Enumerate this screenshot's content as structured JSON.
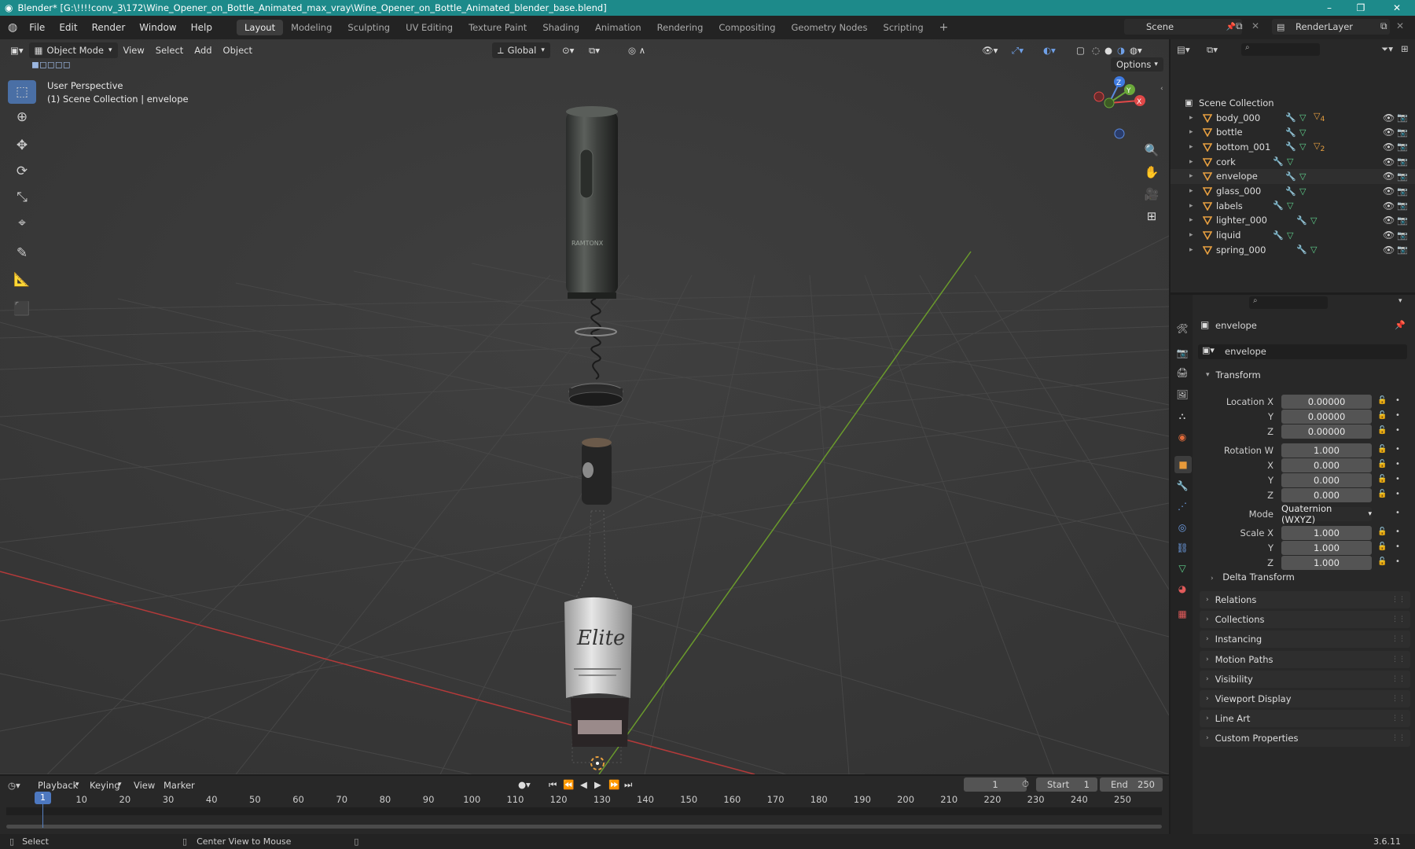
{
  "titlebar": {
    "title": "Blender* [G:\\!!!!conv_3\\172\\Wine_Opener_on_Bottle_Animated_max_vray\\Wine_Opener_on_Bottle_Animated_blender_base.blend]",
    "minimize": "–",
    "maximize": "❐",
    "close": "✕"
  },
  "menu": {
    "items": [
      "File",
      "Edit",
      "Render",
      "Window",
      "Help"
    ],
    "workspaces": [
      "Layout",
      "Modeling",
      "Sculpting",
      "UV Editing",
      "Texture Paint",
      "Shading",
      "Animation",
      "Rendering",
      "Compositing",
      "Geometry Nodes",
      "Scripting"
    ],
    "active_workspace": "Layout",
    "add_tab": "+",
    "scene": "Scene",
    "render_layer": "RenderLayer"
  },
  "viewport": {
    "mode": "Object Mode",
    "menus": [
      "View",
      "Select",
      "Add",
      "Object"
    ],
    "orientation": "Global",
    "options": "Options",
    "perspective_label": "User Perspective",
    "collection_label": "(1) Scene Collection | envelope",
    "bottle_label_text": "Elite",
    "brand_text": "RAMTONX",
    "gizmo_axes": {
      "x": "X",
      "y": "Y",
      "z": "Z"
    }
  },
  "outliner": {
    "root": "Scene Collection",
    "items": [
      {
        "name": "body_000",
        "extra_count": "4"
      },
      {
        "name": "bottle",
        "extra_count": ""
      },
      {
        "name": "bottom_001",
        "extra_count": "2"
      },
      {
        "name": "cork",
        "extra_count": ""
      },
      {
        "name": "envelope",
        "extra_count": ""
      },
      {
        "name": "glass_000",
        "extra_count": ""
      },
      {
        "name": "labels",
        "extra_count": ""
      },
      {
        "name": "lighter_000",
        "extra_count": ""
      },
      {
        "name": "liquid",
        "extra_count": ""
      },
      {
        "name": "spring_000",
        "extra_count": ""
      }
    ]
  },
  "properties": {
    "object_name": "envelope",
    "object_field": "envelope",
    "transform_header": "Transform",
    "location_label": "Location X",
    "location": [
      "0.00000",
      "0.00000",
      "0.00000"
    ],
    "rotation_label": "Rotation W",
    "rotation": [
      "1.000",
      "0.000",
      "0.000",
      "0.000"
    ],
    "axis_y": "Y",
    "axis_z": "Z",
    "axis_x": "X",
    "mode_label": "Mode",
    "mode_value": "Quaternion (WXYZ)",
    "scale_label": "Scale X",
    "scale": [
      "1.000",
      "1.000",
      "1.000"
    ],
    "delta_transform": "Delta Transform",
    "panels": [
      "Relations",
      "Collections",
      "Instancing",
      "Motion Paths",
      "Visibility",
      "Viewport Display",
      "Line Art",
      "Custom Properties"
    ]
  },
  "timeline": {
    "menus": [
      "Playback",
      "Keying",
      "View",
      "Marker"
    ],
    "current_frame": "1",
    "start_label": "Start",
    "start": "1",
    "end_label": "End",
    "end": "250",
    "ticks": [
      "1",
      "10",
      "20",
      "30",
      "40",
      "50",
      "60",
      "70",
      "80",
      "90",
      "100",
      "110",
      "120",
      "130",
      "140",
      "150",
      "160",
      "170",
      "180",
      "190",
      "200",
      "210",
      "220",
      "230",
      "240",
      "250"
    ]
  },
  "status": {
    "select": "Select",
    "center_view": "Center View to Mouse",
    "version": "3.6.11"
  }
}
